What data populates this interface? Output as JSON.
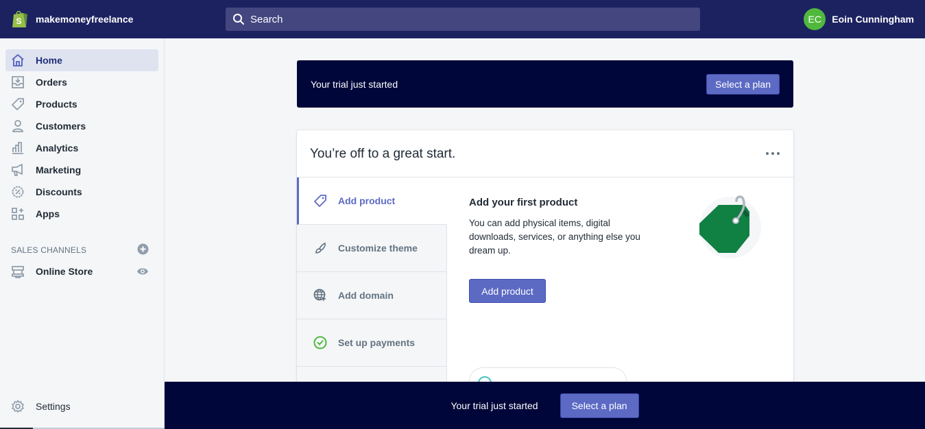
{
  "topbar": {
    "store_name": "makemoneyfreelance",
    "search_placeholder": "Search",
    "user_initials": "EC",
    "user_name": "Eoin Cunningham",
    "avatar_color": "#50b83c"
  },
  "sidebar": {
    "items": [
      {
        "label": "Home",
        "icon": "home-icon",
        "active": true
      },
      {
        "label": "Orders",
        "icon": "orders-icon"
      },
      {
        "label": "Products",
        "icon": "tag-icon"
      },
      {
        "label": "Customers",
        "icon": "person-icon"
      },
      {
        "label": "Analytics",
        "icon": "bar-chart-icon"
      },
      {
        "label": "Marketing",
        "icon": "megaphone-icon"
      },
      {
        "label": "Discounts",
        "icon": "discount-icon"
      },
      {
        "label": "Apps",
        "icon": "apps-icon"
      }
    ],
    "sales_channels_title": "SALES CHANNELS",
    "channels": [
      {
        "label": "Online Store",
        "icon": "store-icon"
      }
    ],
    "settings_label": "Settings"
  },
  "trial_banner": {
    "text": "Your trial just started",
    "button_label": "Select a plan"
  },
  "card": {
    "title": "You’re off to a great start.",
    "tabs": [
      {
        "label": "Add product",
        "icon": "tag-icon",
        "active": true
      },
      {
        "label": "Customize theme",
        "icon": "brush-icon"
      },
      {
        "label": "Add domain",
        "icon": "globe-icon"
      },
      {
        "label": "Set up payments",
        "icon": "check-circle-icon",
        "completed": true
      }
    ],
    "panel": {
      "title": "Add your first product",
      "description": "You can add physical items, digital downloads, services, or anything else you dream up.",
      "button_label": "Add product"
    }
  },
  "footer_banner": {
    "text": "Your trial just started",
    "button_label": "Select a plan"
  },
  "colors": {
    "topbar": "#1c2260",
    "accent": "#5c6ac4",
    "banner": "#000639",
    "success": "#50b83c",
    "tag_green": "#108043"
  }
}
